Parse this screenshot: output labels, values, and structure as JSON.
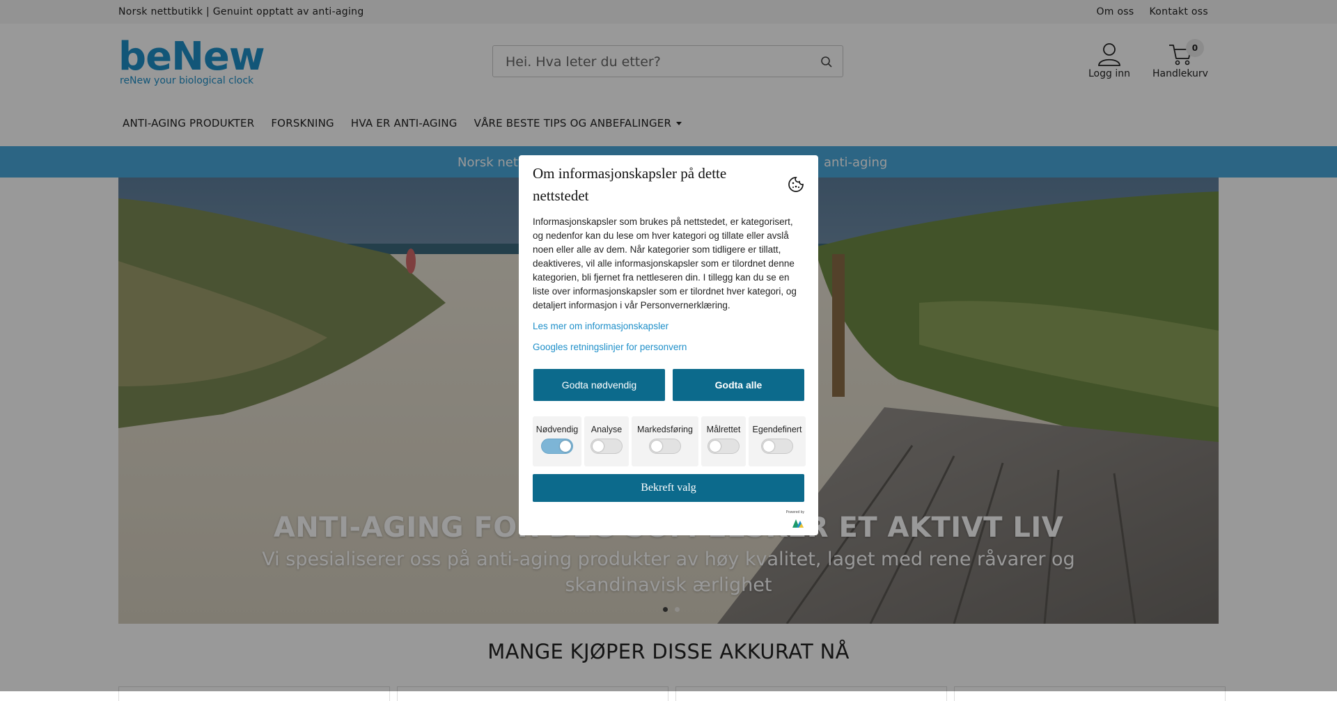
{
  "topbar": {
    "tagline": "Norsk nettbutikk | Genuint opptatt av anti-aging",
    "links": [
      "Om oss",
      "Kontakt oss"
    ]
  },
  "logo": {
    "word": "beNew",
    "tagline": "reNew your biological clock"
  },
  "search": {
    "placeholder": "Hei. Hva leter du etter?"
  },
  "account": {
    "login_label": "Logg inn",
    "cart_label": "Handlekurv",
    "cart_count": "0"
  },
  "nav": {
    "items": [
      "ANTI-AGING PRODUKTER",
      "FORSKNING",
      "HVA ER ANTI-AGING",
      "VÅRE BESTE TIPS OG ANBEFALINGER"
    ]
  },
  "banner": {
    "visible_left": "Norsk nett",
    "visible_right": "anti-aging"
  },
  "hero": {
    "title": "ANTI-AGING FOR DEG SOM ELSKER ET AKTIVT LIV",
    "subtitle": "Vi spesialiserer oss på anti-aging produkter av høy kvalitet, laget med rene råvarer og skandinavisk ærlighet",
    "slide_count": 2,
    "active_slide": 1
  },
  "section": {
    "heading": "MANGE KJØPER DISSE AKKURAT NÅ"
  },
  "cookie_modal": {
    "title": "Om informasjonskapsler på dette nettstedet",
    "body": "Informasjonskapsler som brukes på nettstedet, er kategorisert, og nedenfor kan du lese om hver kategori og tillate eller avslå noen eller alle av dem. Når kategorier som tidligere er tillatt, deaktiveres, vil alle informasjonskapsler som er tilordnet denne kategorien, bli fjernet fra nettleseren din. I tillegg kan du se en liste over informasjonskapsler som er tilordnet hver kategori, og detaljert informasjon i vår Personvernerklæring.",
    "link_cookies": "Les mer om informasjonskapsler",
    "link_google": "Googles retningslinjer for personvern",
    "btn_necessary": "Godta nødvendig",
    "btn_all": "Godta alle",
    "categories": [
      {
        "label": "Nødvendig",
        "on": true
      },
      {
        "label": "Analyse",
        "on": false
      },
      {
        "label": "Markedsføring",
        "on": false
      },
      {
        "label": "Målrettet",
        "on": false
      },
      {
        "label": "Egendefinert",
        "on": false
      }
    ],
    "confirm": "Bekreft valg",
    "powered_by": "Powered by"
  },
  "colors": {
    "brand": "#1e8fc9",
    "banner": "#4aa8dc",
    "modal_button": "#0c6a8c",
    "overlay": "rgba(0,0,0,0.40)"
  }
}
